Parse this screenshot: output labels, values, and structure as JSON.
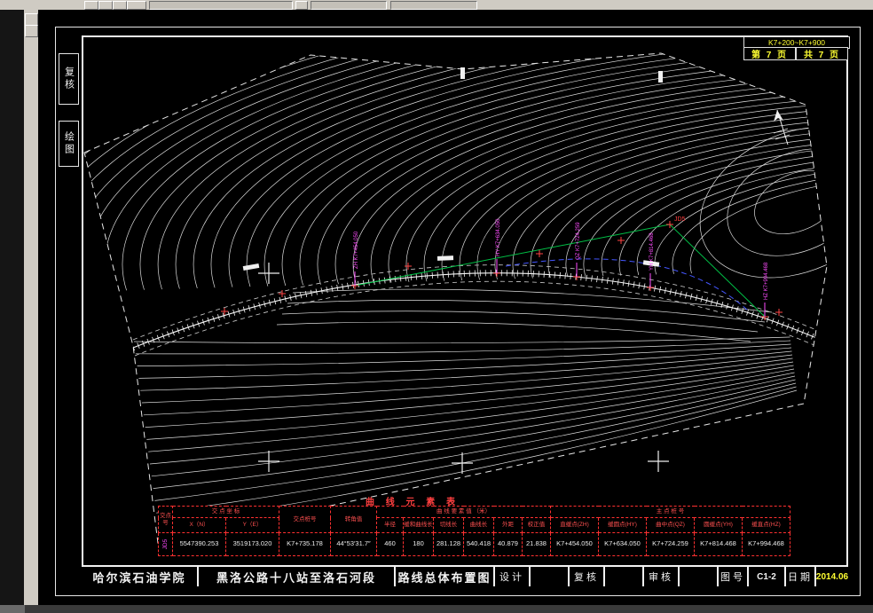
{
  "sheet_header": {
    "station_range": "K7+200~K7+900",
    "page": "第 7 页",
    "pages_total": "共 7 页",
    "side_box_top": "复核",
    "side_box_bottom": "绘图"
  },
  "plan": {
    "jd_label": "JD5",
    "markers": [
      {
        "label": "ZH K7+454.050"
      },
      {
        "label": "HY K7+634.050"
      },
      {
        "label": "QZ K7+724.259"
      },
      {
        "label": "YH K7+814.468"
      },
      {
        "label": "HZ K7+994.468"
      }
    ]
  },
  "curve_table": {
    "title": "曲 线 元 素 表",
    "col_point": "交点号",
    "grp_coord": "交 点 坐 标",
    "grp_station": "交点桩号",
    "grp_angle": "转角值",
    "grp_elements": "曲 线 要 素 值 （米）",
    "grp_main": "主 点 桩 号",
    "sub_x": "X（N）",
    "sub_y": "Y（E）",
    "sub_r": "半径",
    "sub_ls": "缓和曲线长",
    "sub_t": "切线长",
    "sub_l": "曲线长",
    "sub_e": "外距",
    "sub_j": "校正值",
    "sub_zh": "直缓点(ZH)",
    "sub_hy": "缓圆点(HY)",
    "sub_qz": "曲中点(QZ)",
    "sub_yh": "圆缓点(YH)",
    "sub_hz": "缓直点(HZ)",
    "val_point": "JD5",
    "val_x": "5547390.253",
    "val_y": "3519173.020",
    "val_station": "K7+735.178",
    "val_angle": "44°53′31.7″",
    "val_r": "460",
    "val_ls": "180",
    "val_t": "281.128",
    "val_l": "540.418",
    "val_e": "40.879",
    "val_j": "21.838",
    "val_zh": "K7+454.050",
    "val_hy": "K7+634.050",
    "val_qz": "K7+724.259",
    "val_yh": "K7+814.468",
    "val_hz": "K7+994.468"
  },
  "title_block": {
    "org": "哈尔滨石油学院",
    "project": "黑洛公路十八站至洛石河段",
    "drawing_title": "路线总体布置图",
    "design": "设计",
    "check": "复核",
    "review": "审核",
    "sheet_no_label": "图号",
    "sheet_no": "C1-2",
    "date_label": "日期",
    "date": "2014.06"
  },
  "colors": {
    "annotation_red": "#ff3030",
    "marker_magenta": "#ff4cff",
    "tangent_green": "#00c046",
    "accent_yellow": "#ffff32",
    "line_blue": "#4456ff"
  }
}
